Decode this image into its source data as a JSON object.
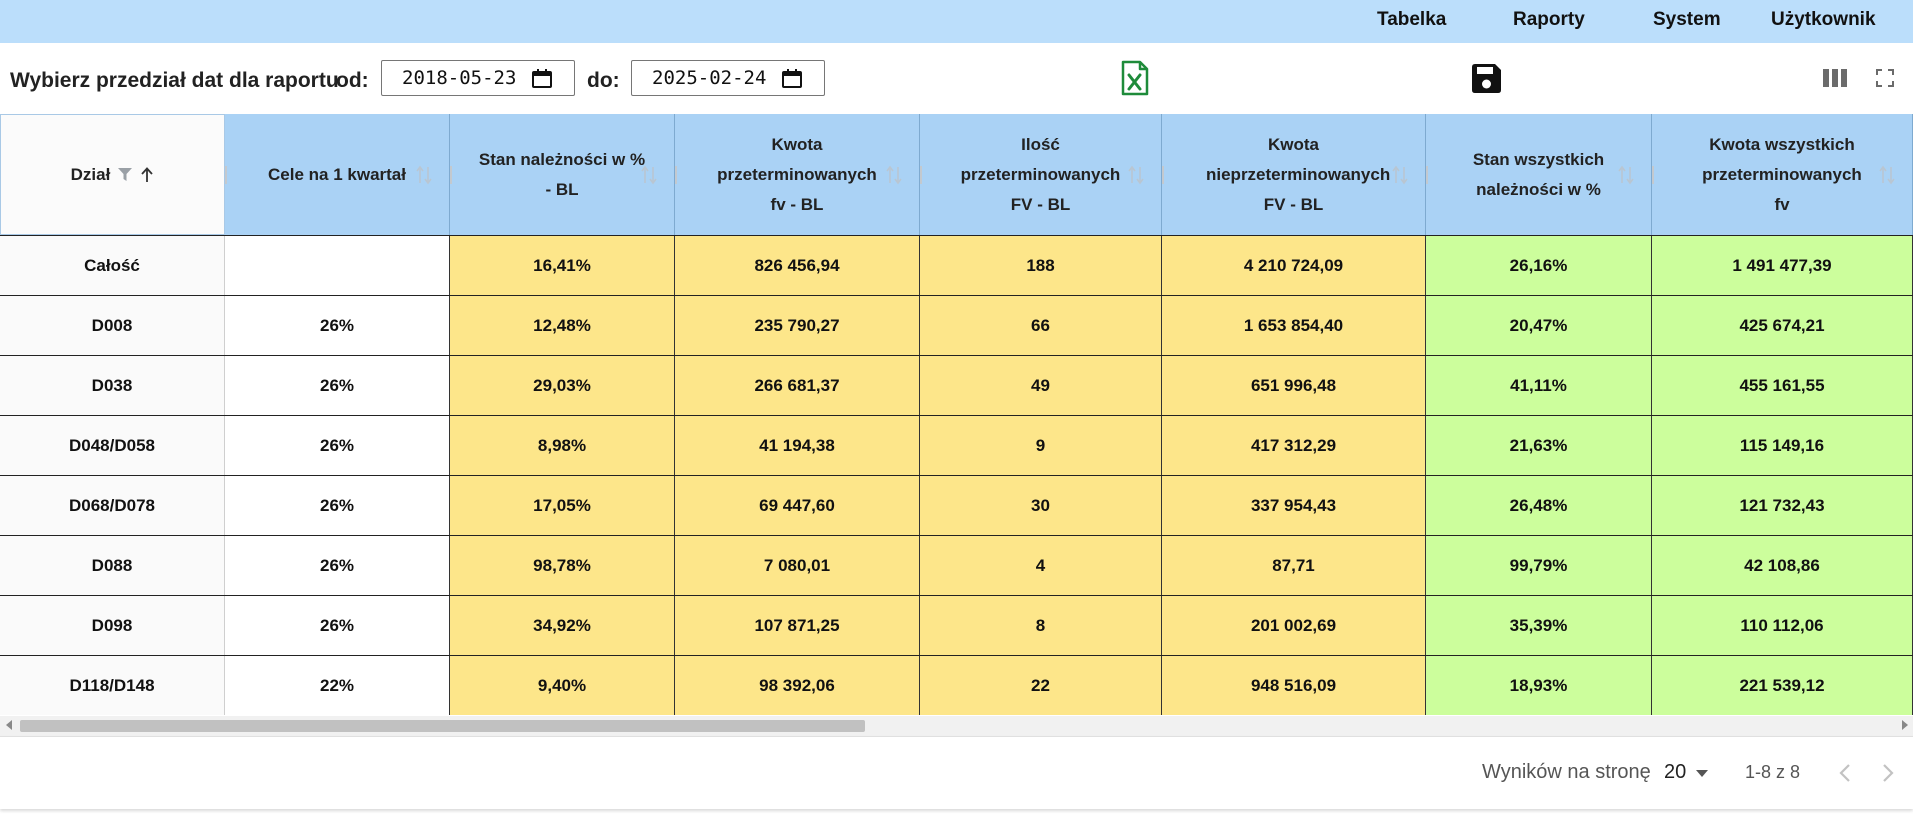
{
  "menu": {
    "items": [
      "Tabelka",
      "Raporty",
      "System",
      "Użytkownik"
    ]
  },
  "toolbar": {
    "prompt": "Wybierz przedział dat dla raportu",
    "from_label": "od:",
    "from_value": "2018-05-23",
    "to_label": "do:",
    "to_value": "2025-02-24",
    "icons": [
      "excel-export-icon",
      "save-icon",
      "columns-icon",
      "fullscreen-icon"
    ]
  },
  "table": {
    "headers": [
      "Dział",
      "Cele na 1 kwartał",
      "Stan należności w % - BL",
      "Kwota przeterminowanych fv - BL",
      "Ilość przeterminowanych FV - BL",
      "Kwota nieprzeterminowanych FV - BL",
      "Stan wszystkich należności w %",
      "Kwota wszystkich przeterminowanych fv"
    ],
    "rows": [
      [
        "Całość",
        "",
        "16,41%",
        "826 456,94",
        "188",
        "4 210 724,09",
        "26,16%",
        "1 491 477,39"
      ],
      [
        "D008",
        "26%",
        "12,48%",
        "235 790,27",
        "66",
        "1 653 854,40",
        "20,47%",
        "425 674,21"
      ],
      [
        "D038",
        "26%",
        "29,03%",
        "266 681,37",
        "49",
        "651 996,48",
        "41,11%",
        "455 161,55"
      ],
      [
        "D048/D058",
        "26%",
        "8,98%",
        "41 194,38",
        "9",
        "417 312,29",
        "21,63%",
        "115 149,16"
      ],
      [
        "D068/D078",
        "26%",
        "17,05%",
        "69 447,60",
        "30",
        "337 954,43",
        "26,48%",
        "121 732,43"
      ],
      [
        "D088",
        "26%",
        "98,78%",
        "7 080,01",
        "4",
        "87,71",
        "99,79%",
        "42 108,86"
      ],
      [
        "D098",
        "26%",
        "34,92%",
        "107 871,25",
        "8",
        "201 002,69",
        "35,39%",
        "110 112,06"
      ],
      [
        "D118/D148",
        "22%",
        "9,40%",
        "98 392,06",
        "22",
        "948 516,09",
        "18,93%",
        "221 539,12"
      ]
    ]
  },
  "footer": {
    "rows_per_page_label": "Wyników na stronę",
    "rows_per_page_value": "20",
    "range": "1-8 z 8"
  },
  "colors": {
    "menu_bg": "#bbdefb",
    "header_bg": "#aad2f5",
    "yellow": "#fde68a",
    "green": "#ccfe9c",
    "excel_green": "#1e8b3a"
  }
}
